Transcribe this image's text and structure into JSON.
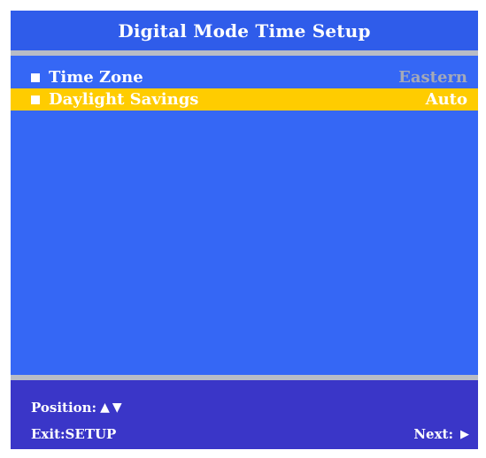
{
  "title": "Digital Mode Time Setup",
  "menu": {
    "items": [
      {
        "label": "Time Zone",
        "value": "Eastern",
        "selected": false
      },
      {
        "label": "Daylight Savings",
        "value": "Auto",
        "selected": true
      }
    ]
  },
  "footer": {
    "position_label": "Position:",
    "position_up_icon": "▲",
    "position_down_icon": "▼",
    "exit_label": "Exit:",
    "exit_key": "SETUP",
    "next_label": "Next:",
    "next_icon": "▶"
  },
  "icons": {
    "bullet": "square-bullet-icon",
    "up": "triangle-up-icon",
    "down": "triangle-down-icon",
    "next": "triangle-right-icon"
  },
  "colors": {
    "background": "#3567f5",
    "title_bar": "#2f5cea",
    "divider": "#b8bcc6",
    "highlight": "#ffcc00",
    "footer": "#3a36c8",
    "inactive_value": "#a4a9b8",
    "text": "#ffffff"
  }
}
